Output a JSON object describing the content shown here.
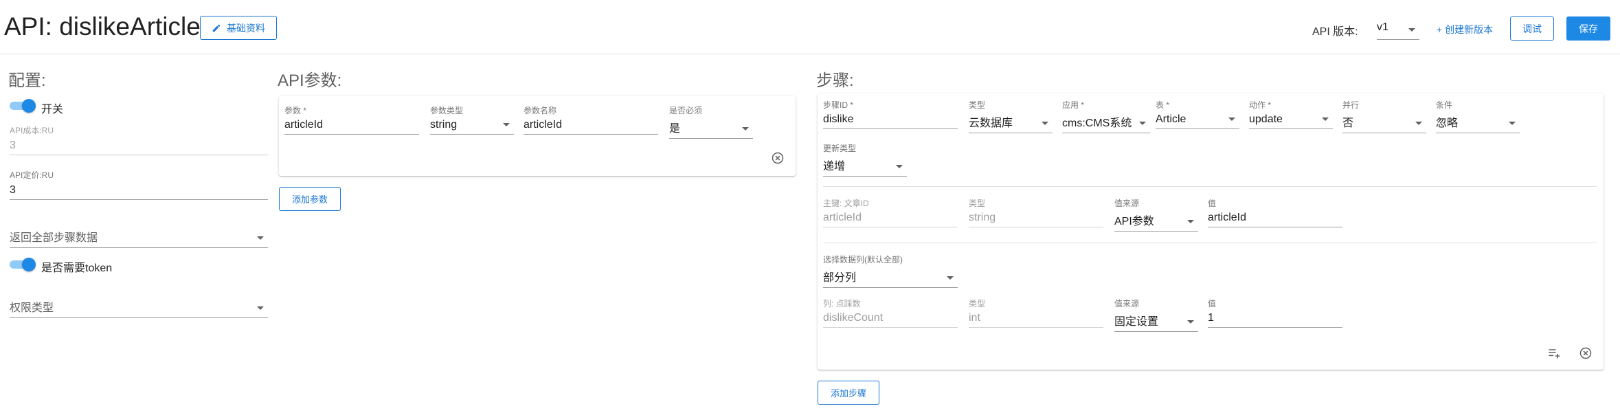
{
  "header": {
    "title": "API: dislikeArticle",
    "basic_info_label": "基础资料",
    "version_label": "API 版本:",
    "version_value": "v1",
    "create_version_label": "+ 创建新版本",
    "debug_label": "调试",
    "save_label": "保存"
  },
  "config": {
    "title": "配置:",
    "switch_label": "开关",
    "cost_label": "API成本:RU",
    "cost_value": "3",
    "price_label": "API定价:RU",
    "price_value": "3",
    "return_steps_placeholder": "返回全部步骤数据",
    "token_label": "是否需要token",
    "permission_placeholder": "权限类型"
  },
  "params": {
    "title": "API参数:",
    "headers": [
      "参数 *",
      "参数类型",
      "参数名称",
      "是否必须"
    ],
    "row": {
      "name": "articleId",
      "type": "string",
      "label": "articleId",
      "required": "是"
    },
    "add_label": "添加参数"
  },
  "steps": {
    "title": "步骤:",
    "step_fields": [
      {
        "label": "步骤ID *",
        "value": "dislike"
      },
      {
        "label": "类型",
        "value": "云数据库"
      },
      {
        "label": "应用 *",
        "value": "cms:CMS系统"
      },
      {
        "label": "表 *",
        "value": "Article"
      },
      {
        "label": "动作 *",
        "value": "update"
      },
      {
        "label": "并行",
        "value": "否"
      },
      {
        "label": "条件",
        "value": "忽略"
      }
    ],
    "update_type": {
      "label": "更新类型",
      "value": "递增"
    },
    "key_row": {
      "key_label": "主键: 文章ID",
      "key_value": "articleId",
      "type_label": "类型",
      "type_value": "string",
      "source_label": "值来源",
      "source_value": "API参数",
      "value_label": "值",
      "value_value": "articleId"
    },
    "columns_select": {
      "label": "选择数据列(默认全部)",
      "value": "部分列"
    },
    "column_row": {
      "col_label": "列: 点踩数",
      "col_value": "dislikeCount",
      "type_label": "类型",
      "type_value": "int",
      "source_label": "值来源",
      "source_value": "固定设置",
      "value_label": "值",
      "value_value": "1"
    },
    "add_label": "添加步骤"
  },
  "colors": {
    "accent": "#1e88e5",
    "accent_dark": "#1976d2",
    "track": "#90caf9"
  },
  "icons": [
    "pencil-icon",
    "chevron-down-icon",
    "close-circle-icon",
    "playlist-add-icon"
  ]
}
